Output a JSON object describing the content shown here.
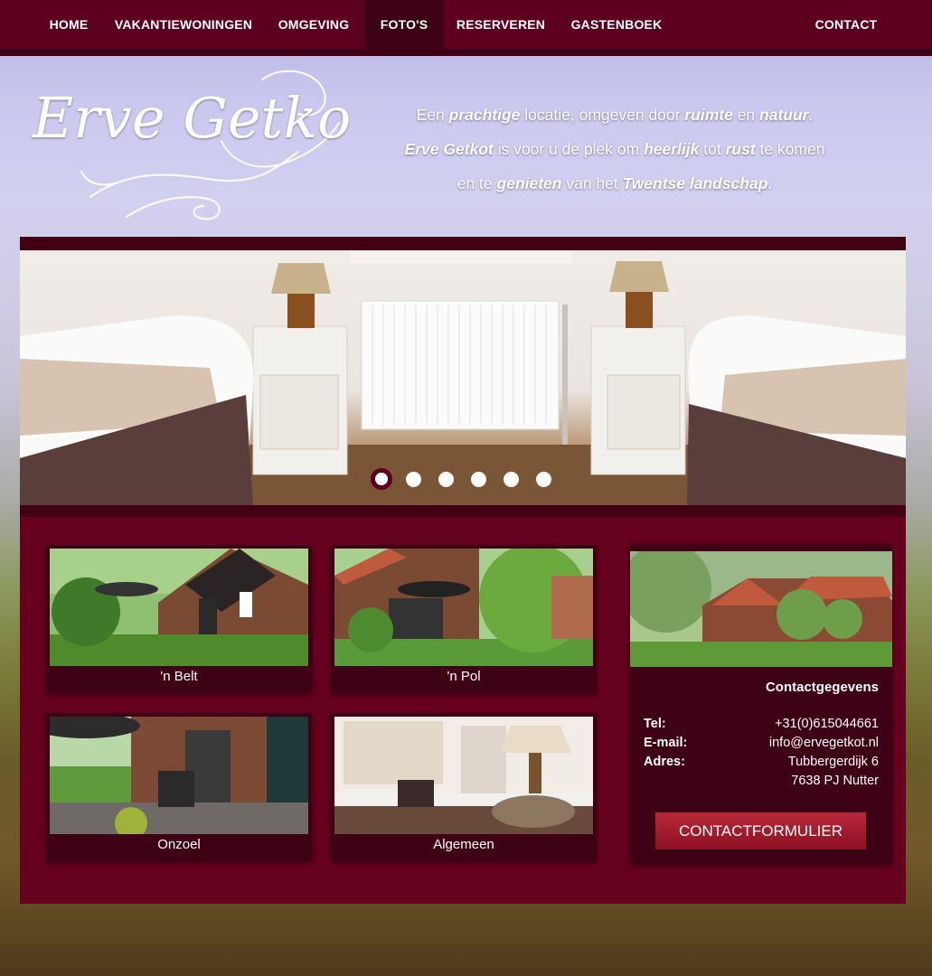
{
  "nav": {
    "items": [
      {
        "label": "HOME"
      },
      {
        "label": "VAKANTIEWONINGEN"
      },
      {
        "label": "OMGEVING"
      },
      {
        "label": "FOTO'S"
      },
      {
        "label": "RESERVEREN"
      },
      {
        "label": "GASTENBOEK"
      },
      {
        "label": "CONTACT"
      }
    ],
    "active_index": 3
  },
  "brand": {
    "logo_text": "Erve Getkot"
  },
  "tagline": {
    "line1": [
      "Een ",
      "prachtige",
      " locatie, omgeven door ",
      "ruimte",
      " en ",
      "natuur",
      "."
    ],
    "line2": [
      "Erve Getkot",
      " is voor u de plek om ",
      "heerlijk",
      " tot ",
      "rust",
      " te komen"
    ],
    "line3": [
      "en te ",
      "genieten",
      " van het ",
      "Twentse landschap",
      "."
    ]
  },
  "slider": {
    "slide_count": 6,
    "active_slide": 0
  },
  "cards": [
    {
      "label": "'n Belt"
    },
    {
      "label": "'n Pol"
    },
    {
      "label": "Onzoel"
    },
    {
      "label": "Algemeen"
    }
  ],
  "contact": {
    "title": "Contactgegevens",
    "rows": [
      {
        "key": "Tel:",
        "value": "+31(0)615044661"
      },
      {
        "key": "E-mail:",
        "value": "info@ervegetkot.nl"
      },
      {
        "key": "Adres:",
        "value": "Tubbergerdijk 6"
      },
      {
        "key": "",
        "value": "7638 PJ Nutter"
      }
    ],
    "button_label": "CONTACTFORMULIER"
  },
  "colors": {
    "brand": "#66001f",
    "brand_dark": "#3d0014",
    "button": "#a51a2e"
  }
}
